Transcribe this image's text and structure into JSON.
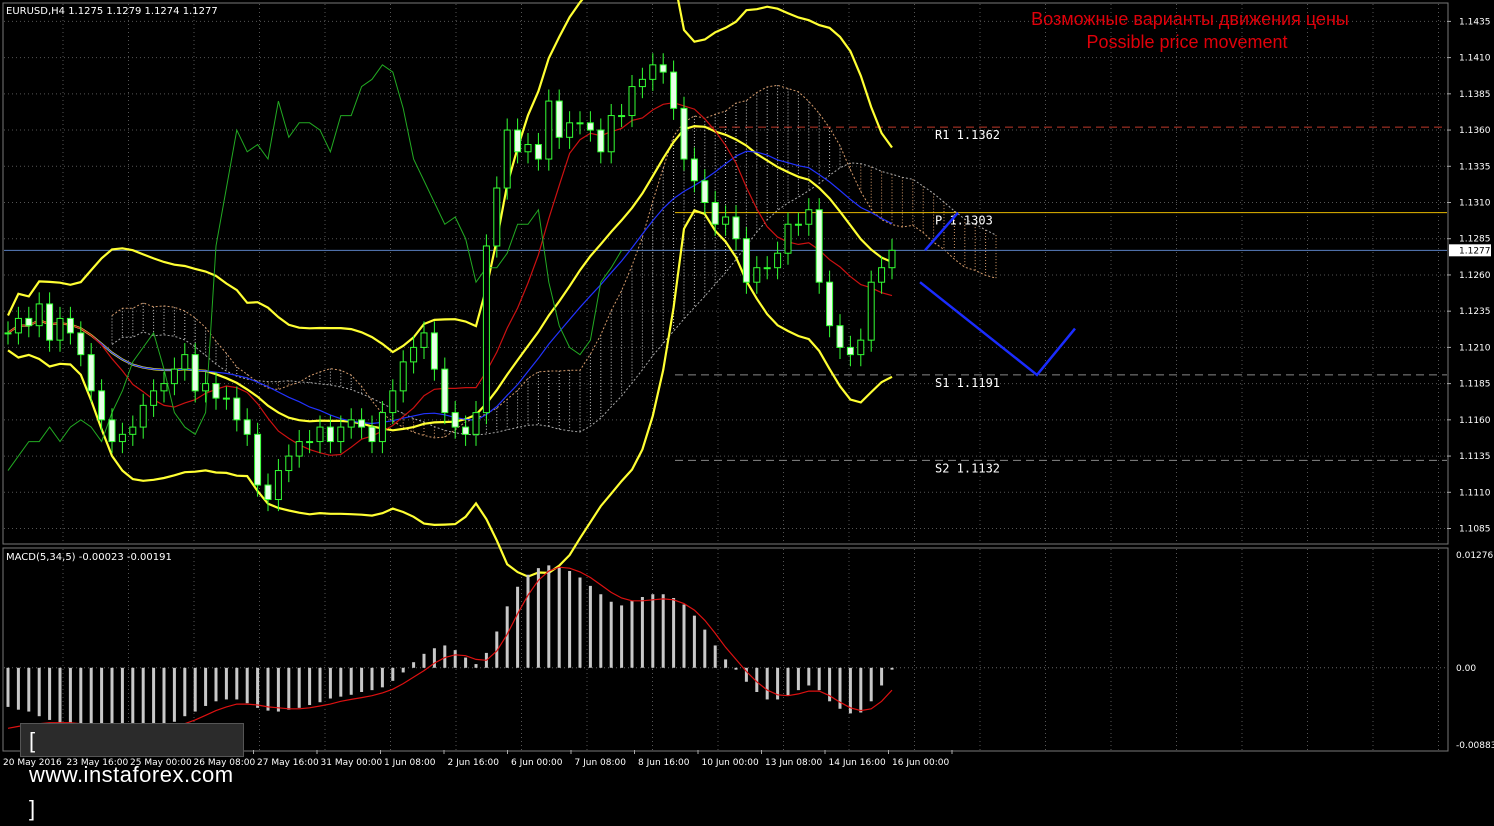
{
  "main_header": "EURUSD,H4  1.1275 1.1279 1.1274 1.1277",
  "annotation": {
    "line1": "Возможные варианты движения цены",
    "line2": "Possible price movement",
    "color": "#e0000a"
  },
  "levels": [
    {
      "label": "R1  1.1362",
      "value": 1.1362,
      "color": "#c0392b",
      "style": "dashed"
    },
    {
      "label": "P  1.1303",
      "value": 1.1303,
      "color": "#e6b800",
      "style": "solid"
    },
    {
      "label": "S1  1.1191",
      "value": 1.1191,
      "color": "#888888",
      "style": "dashed"
    },
    {
      "label": "S2  1.1132",
      "value": 1.1132,
      "color": "#888888",
      "style": "dashed"
    }
  ],
  "current_price": "1.1277",
  "price_axis_labels": [
    "1.1435",
    "1.1410",
    "1.1385",
    "1.1360",
    "1.1335",
    "1.1310",
    "1.1285",
    "1.1260",
    "1.1235",
    "1.1210",
    "1.1185",
    "1.1160",
    "1.1135",
    "1.1110",
    "1.1085"
  ],
  "macd_header": "MACD(5,34,5) -0.00023 -0.00191",
  "macd_axis_labels": [
    "0.01276",
    "0.00",
    "-0.00883"
  ],
  "time_labels": [
    "20 May 2016",
    "23 May 16:00",
    "25 May 00:00",
    "26 May 08:00",
    "27 May 16:00",
    "31 May 00:00",
    "1 Jun 08:00",
    "2 Jun 16:00",
    "6 Jun 00:00",
    "7 Jun 08:00",
    "8 Jun 16:00",
    "10 Jun 00:00",
    "13 Jun 08:00",
    "14 Jun 16:00",
    "16 Jun 00:00"
  ],
  "logo_text": "[ www.instaforex.com ]",
  "chart_data": {
    "type": "line",
    "symbol": "EURUSD",
    "timeframe": "H4",
    "price_range": [
      1.1075,
      1.1447
    ],
    "macd_range": [
      -0.00883,
      0.01276
    ],
    "grid": true,
    "close_series": [
      1.122,
      1.123,
      1.1225,
      1.124,
      1.1215,
      1.123,
      1.122,
      1.1205,
      1.118,
      1.116,
      1.1145,
      1.115,
      1.1155,
      1.117,
      1.118,
      1.1185,
      1.1195,
      1.1205,
      1.118,
      1.1185,
      1.1175,
      1.1175,
      1.116,
      1.115,
      1.1115,
      1.1105,
      1.1125,
      1.1135,
      1.1145,
      1.1145,
      1.1155,
      1.1145,
      1.1155,
      1.116,
      1.1155,
      1.1145,
      1.1165,
      1.118,
      1.12,
      1.121,
      1.122,
      1.1195,
      1.1165,
      1.1155,
      1.115,
      1.1165,
      1.128,
      1.132,
      1.136,
      1.1345,
      1.135,
      1.134,
      1.138,
      1.1355,
      1.1365,
      1.1365,
      1.136,
      1.1345,
      1.137,
      1.137,
      1.139,
      1.1395,
      1.1405,
      1.14,
      1.1375,
      1.134,
      1.1325,
      1.131,
      1.1295,
      1.13,
      1.1285,
      1.1255,
      1.1265,
      1.1265,
      1.1275,
      1.1295,
      1.1295,
      1.1305,
      1.1255,
      1.1225,
      1.121,
      1.1205,
      1.1215,
      1.1255,
      1.1265,
      1.1277
    ],
    "macd_histogram": [
      -0.0042,
      -0.0045,
      -0.0047,
      -0.0052,
      -0.0056,
      -0.0059,
      -0.0061,
      -0.0062,
      -0.0064,
      -0.0066,
      -0.0067,
      -0.0068,
      -0.0068,
      -0.0067,
      -0.0065,
      -0.0063,
      -0.0058,
      -0.0052,
      -0.0047,
      -0.0041,
      -0.0036,
      -0.0034,
      -0.0034,
      -0.0038,
      -0.0043,
      -0.0046,
      -0.0047,
      -0.0045,
      -0.0043,
      -0.004,
      -0.0037,
      -0.0033,
      -0.0031,
      -0.0029,
      -0.0026,
      -0.0024,
      -0.0021,
      -0.0014,
      -0.0005,
      0.0006,
      0.0015,
      0.0021,
      0.0024,
      0.0019,
      0.0011,
      0.0004,
      0.0016,
      0.0039,
      0.0066,
      0.0087,
      0.01,
      0.0107,
      0.011,
      0.0108,
      0.0104,
      0.0097,
      0.0088,
      0.0079,
      0.0071,
      0.0067,
      0.0072,
      0.0076,
      0.0079,
      0.0079,
      0.0075,
      0.0068,
      0.0056,
      0.0041,
      0.0024,
      0.0009,
      -0.0002,
      -0.0015,
      -0.0026,
      -0.0034,
      -0.0034,
      -0.003,
      -0.0024,
      -0.0019,
      -0.0024,
      -0.0036,
      -0.0044,
      -0.0049,
      -0.0048,
      -0.0036,
      -0.0019,
      -0.0002
    ],
    "macd_signal": [
      -0.0065,
      -0.0063,
      -0.0061,
      -0.006,
      -0.0059,
      -0.0059,
      -0.0059,
      -0.006,
      -0.0061,
      -0.0062,
      -0.0063,
      -0.0064,
      -0.0065,
      -0.0066,
      -0.0066,
      -0.0065,
      -0.0063,
      -0.006,
      -0.0056,
      -0.0051,
      -0.0046,
      -0.0042,
      -0.0039,
      -0.0039,
      -0.004,
      -0.0042,
      -0.0043,
      -0.0044,
      -0.0044,
      -0.0043,
      -0.0041,
      -0.0039,
      -0.0036,
      -0.0034,
      -0.0032,
      -0.003,
      -0.0027,
      -0.0023,
      -0.0017,
      -0.001,
      -0.0003,
      0.0005,
      0.0011,
      0.0014,
      0.0013,
      0.0009,
      0.0008,
      0.0018,
      0.0036,
      0.0058,
      0.0078,
      0.0094,
      0.0104,
      0.0108,
      0.0107,
      0.0103,
      0.0097,
      0.0089,
      0.0081,
      0.0075,
      0.0072,
      0.0072,
      0.0073,
      0.0074,
      0.0073,
      0.0069,
      0.0062,
      0.0051,
      0.0037,
      0.0022,
      0.0009,
      -0.0004,
      -0.0015,
      -0.0024,
      -0.0029,
      -0.003,
      -0.0028,
      -0.0025,
      -0.0025,
      -0.003,
      -0.0037,
      -0.0043,
      -0.0046,
      -0.0044,
      -0.0036,
      -0.0024
    ],
    "forecast_path": [
      [
        1.1277,
        1.1303
      ],
      [
        1.1255,
        1.1191,
        1.1223
      ]
    ]
  }
}
